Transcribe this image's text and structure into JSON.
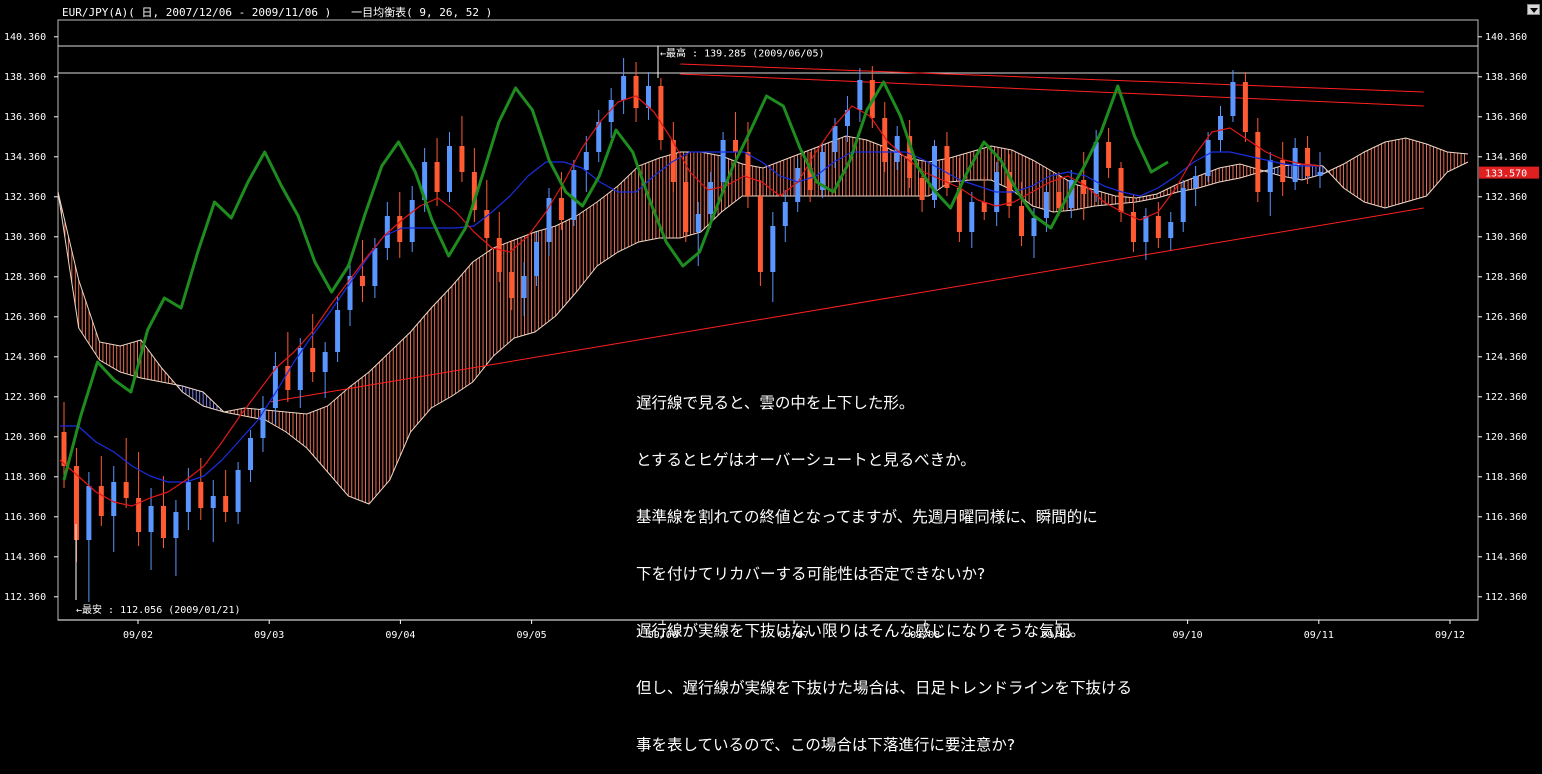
{
  "header": {
    "title": "EUR/JPY(A)( 日, 2007/12/06 - 2009/11/06 )   一目均衡表( 9, 26, 52 )"
  },
  "chart_data": {
    "type": "candlestick",
    "symbol": "EUR/JPY(A)",
    "indicator": "一目均衡表( 9, 26, 52 )",
    "ylim": [
      111.2,
      141.2
    ],
    "y_ticks": [
      "140.360",
      "138.360",
      "136.360",
      "134.360",
      "132.360",
      "130.360",
      "128.360",
      "126.360",
      "124.360",
      "122.360",
      "120.360",
      "118.360",
      "116.360",
      "114.360",
      "112.360"
    ],
    "x_ticks": [
      "09/02",
      "09/03",
      "09/04",
      "09/05",
      "09/06",
      "09/07",
      "09/08",
      "09/09",
      "09/10",
      "09/11",
      "09/12"
    ],
    "current_price": "133.570",
    "high_label": "←最高 : 139.285 (2009/06/05)",
    "low_label": "←最安 : 112.056 (2009/01/21)",
    "high_value": 139.285,
    "low_value": 112.056,
    "candle_ohlc": [
      [
        120.6,
        122.1,
        117.8,
        118.9
      ],
      [
        118.9,
        119.8,
        114.1,
        115.2
      ],
      [
        115.2,
        118.6,
        112.1,
        117.9
      ],
      [
        117.9,
        119.4,
        115.9,
        116.4
      ],
      [
        116.4,
        118.9,
        114.6,
        118.1
      ],
      [
        118.1,
        120.3,
        116.8,
        117.3
      ],
      [
        117.3,
        119.6,
        114.9,
        115.6
      ],
      [
        115.6,
        117.8,
        113.7,
        116.9
      ],
      [
        116.9,
        118.4,
        114.8,
        115.3
      ],
      [
        115.3,
        117.2,
        113.4,
        116.6
      ],
      [
        116.6,
        118.8,
        115.7,
        118.1
      ],
      [
        118.1,
        119.3,
        116.2,
        116.8
      ],
      [
        116.8,
        118.2,
        115.1,
        117.4
      ],
      [
        117.4,
        118.7,
        116.1,
        116.6
      ],
      [
        116.6,
        119.1,
        116.0,
        118.7
      ],
      [
        118.7,
        120.7,
        118.1,
        120.3
      ],
      [
        120.3,
        122.4,
        119.6,
        121.8
      ],
      [
        121.8,
        124.6,
        121.0,
        123.9
      ],
      [
        123.9,
        125.6,
        122.1,
        122.7
      ],
      [
        122.7,
        125.3,
        121.8,
        124.8
      ],
      [
        124.8,
        126.5,
        123.1,
        123.6
      ],
      [
        123.6,
        125.1,
        122.3,
        124.6
      ],
      [
        124.6,
        127.4,
        124.1,
        126.7
      ],
      [
        126.7,
        129.1,
        125.9,
        128.4
      ],
      [
        128.4,
        130.2,
        127.1,
        127.9
      ],
      [
        127.9,
        130.3,
        127.3,
        129.8
      ],
      [
        129.8,
        132.1,
        129.2,
        131.4
      ],
      [
        131.4,
        132.6,
        129.3,
        130.1
      ],
      [
        130.1,
        132.9,
        129.6,
        132.2
      ],
      [
        132.2,
        134.8,
        131.6,
        134.1
      ],
      [
        134.1,
        135.3,
        131.9,
        132.6
      ],
      [
        132.6,
        135.6,
        132.1,
        134.9
      ],
      [
        134.9,
        136.4,
        133.1,
        133.6
      ],
      [
        133.6,
        134.8,
        131.1,
        131.7
      ],
      [
        131.7,
        133.2,
        129.6,
        130.3
      ],
      [
        130.3,
        131.6,
        128.1,
        128.6
      ],
      [
        128.6,
        130.2,
        126.7,
        127.3
      ],
      [
        127.3,
        129.1,
        126.4,
        128.4
      ],
      [
        128.4,
        130.6,
        127.9,
        130.1
      ],
      [
        130.1,
        132.8,
        129.4,
        132.3
      ],
      [
        132.3,
        133.6,
        130.7,
        131.2
      ],
      [
        131.2,
        134.2,
        130.9,
        133.7
      ],
      [
        133.7,
        135.4,
        132.6,
        134.6
      ],
      [
        134.6,
        136.7,
        134.1,
        136.1
      ],
      [
        136.1,
        137.8,
        135.3,
        137.2
      ],
      [
        137.2,
        139.3,
        136.5,
        138.4
      ],
      [
        138.4,
        139.1,
        136.1,
        136.8
      ],
      [
        136.8,
        138.6,
        136.2,
        137.9
      ],
      [
        137.9,
        138.3,
        134.7,
        135.2
      ],
      [
        135.2,
        136.1,
        132.6,
        133.1
      ],
      [
        133.1,
        134.4,
        130.1,
        130.6
      ],
      [
        130.6,
        132.1,
        128.9,
        131.5
      ],
      [
        131.5,
        133.6,
        130.8,
        133.1
      ],
      [
        133.1,
        135.6,
        132.7,
        135.2
      ],
      [
        135.2,
        136.6,
        133.9,
        134.6
      ],
      [
        134.6,
        136.1,
        131.8,
        132.4
      ],
      [
        132.4,
        133.2,
        127.9,
        128.6
      ],
      [
        128.6,
        131.6,
        127.1,
        130.9
      ],
      [
        130.9,
        132.7,
        130.1,
        132.1
      ],
      [
        132.1,
        134.3,
        131.6,
        133.8
      ],
      [
        133.8,
        134.6,
        132.1,
        132.7
      ],
      [
        132.7,
        135.1,
        132.3,
        134.6
      ],
      [
        134.6,
        136.3,
        133.8,
        135.9
      ],
      [
        135.9,
        137.4,
        135.1,
        136.7
      ],
      [
        136.7,
        138.8,
        136.1,
        138.2
      ],
      [
        138.2,
        138.9,
        135.8,
        136.3
      ],
      [
        136.3,
        137.1,
        133.6,
        134.1
      ],
      [
        134.1,
        135.9,
        133.7,
        135.4
      ],
      [
        135.4,
        136.2,
        132.8,
        133.3
      ],
      [
        133.3,
        134.1,
        131.6,
        132.2
      ],
      [
        132.2,
        135.2,
        131.8,
        134.9
      ],
      [
        134.9,
        135.6,
        132.4,
        132.8
      ],
      [
        132.8,
        134.3,
        130.1,
        130.6
      ],
      [
        130.6,
        132.6,
        129.8,
        132.1
      ],
      [
        132.1,
        133.4,
        131.2,
        131.6
      ],
      [
        131.6,
        134.1,
        130.9,
        133.6
      ],
      [
        133.6,
        134.5,
        131.3,
        131.9
      ],
      [
        131.9,
        133.1,
        129.9,
        130.4
      ],
      [
        130.4,
        131.8,
        129.3,
        131.3
      ],
      [
        131.3,
        132.9,
        130.6,
        132.6
      ],
      [
        132.6,
        133.6,
        131.4,
        131.8
      ],
      [
        131.8,
        133.7,
        131.3,
        133.2
      ],
      [
        133.2,
        134.6,
        131.2,
        132.5
      ],
      [
        132.5,
        135.7,
        132.1,
        135.1
      ],
      [
        135.1,
        135.8,
        133.3,
        133.8
      ],
      [
        133.8,
        134.1,
        131.1,
        131.6
      ],
      [
        131.6,
        132.5,
        129.6,
        130.1
      ],
      [
        130.1,
        131.8,
        129.2,
        131.4
      ],
      [
        131.4,
        132.1,
        129.8,
        130.3
      ],
      [
        130.3,
        131.6,
        129.7,
        131.1
      ],
      [
        131.1,
        133.2,
        130.6,
        132.8
      ],
      [
        132.8,
        133.9,
        131.9,
        133.4
      ],
      [
        133.4,
        135.6,
        133.1,
        135.2
      ],
      [
        135.2,
        136.9,
        134.6,
        136.4
      ],
      [
        136.4,
        138.7,
        136.1,
        138.1
      ],
      [
        138.1,
        138.6,
        135.1,
        135.6
      ],
      [
        135.6,
        136.3,
        132.1,
        132.6
      ],
      [
        132.6,
        134.6,
        131.4,
        134.2
      ],
      [
        134.2,
        135.1,
        132.4,
        133.1
      ],
      [
        133.1,
        135.3,
        132.7,
        134.8
      ],
      [
        134.8,
        135.4,
        133.0,
        133.4
      ],
      [
        133.4,
        134.6,
        132.8,
        133.6
      ]
    ],
    "chikou_span": [
      118.2,
      121.4,
      124.1,
      123.2,
      122.6,
      125.7,
      127.3,
      126.8,
      129.6,
      132.1,
      131.3,
      133.1,
      134.6,
      132.9,
      131.4,
      129.1,
      127.6,
      128.9,
      131.5,
      133.9,
      135.1,
      133.6,
      131.2,
      129.4,
      130.8,
      133.4,
      136.1,
      137.8,
      136.7,
      134.2,
      132.6,
      131.9,
      133.4,
      135.7,
      134.6,
      132.2,
      130.1,
      128.9,
      129.6,
      131.8,
      133.9,
      135.6,
      137.4,
      136.9,
      134.8,
      133.1,
      132.6,
      134.2,
      136.7,
      138.1,
      136.4,
      133.9,
      132.7,
      131.8,
      133.6,
      135.1,
      134.2,
      132.6,
      131.4,
      130.8,
      132.4,
      133.9,
      135.6,
      137.9,
      135.4,
      133.6,
      134.1
    ],
    "tenkan_sen": [
      119.2,
      118.4,
      117.6,
      117.1,
      116.9,
      117.3,
      117.6,
      118.2,
      118.9,
      120.1,
      121.4,
      122.6,
      123.8,
      124.6,
      125.6,
      126.9,
      128.1,
      129.3,
      130.4,
      131.2,
      131.9,
      132.3,
      131.6,
      130.6,
      129.8,
      129.6,
      130.4,
      131.6,
      133.1,
      134.8,
      136.1,
      137.1,
      137.4,
      136.6,
      135.2,
      133.6,
      132.7,
      132.9,
      133.4,
      133.1,
      132.4,
      133.1,
      134.6,
      135.9,
      136.9,
      136.4,
      135.1,
      134.3,
      133.6,
      133.2,
      132.8,
      132.2,
      131.9,
      132.1,
      132.6,
      133.1,
      133.4,
      132.9,
      132.1,
      131.6,
      131.2,
      131.6,
      132.8,
      134.4,
      135.6,
      135.8,
      135.2,
      134.6,
      134.2,
      134.0,
      133.9
    ],
    "kijun_sen": [
      120.9,
      120.9,
      120.1,
      119.6,
      118.9,
      118.4,
      118.1,
      118.1,
      118.4,
      119.2,
      120.2,
      121.2,
      122.6,
      124.1,
      125.4,
      126.6,
      127.9,
      129.2,
      130.4,
      130.8,
      130.8,
      130.8,
      130.8,
      130.9,
      131.6,
      132.4,
      133.4,
      134.1,
      134.1,
      133.8,
      133.1,
      132.6,
      132.6,
      133.4,
      134.1,
      134.6,
      134.6,
      134.6,
      134.6,
      134.1,
      133.4,
      133.1,
      133.4,
      134.1,
      134.6,
      134.6,
      134.6,
      134.6,
      134.2,
      133.7,
      133.2,
      132.9,
      132.6,
      132.6,
      132.9,
      133.4,
      133.6,
      133.4,
      132.9,
      132.6,
      132.4,
      132.8,
      133.4,
      134.1,
      134.6,
      134.6,
      134.4,
      134.2,
      134.0,
      133.9,
      133.9
    ],
    "senkou_a": [
      132.6,
      128.2,
      125.1,
      124.9,
      125.2,
      123.8,
      122.6,
      121.9,
      121.6,
      121.8,
      121.7,
      121.6,
      121.5,
      121.9,
      122.8,
      123.6,
      124.6,
      125.6,
      126.8,
      127.9,
      129.1,
      129.8,
      130.2,
      130.6,
      130.9,
      131.4,
      132.1,
      132.9,
      133.9,
      134.3,
      134.6,
      134.6,
      134.4,
      134.0,
      133.8,
      134.2,
      134.6,
      135.0,
      135.4,
      135.2,
      134.8,
      134.3,
      134.1,
      134.3,
      134.6,
      134.9,
      134.7,
      134.2,
      133.6,
      133.0,
      132.7,
      132.4,
      132.3,
      132.5,
      133.0,
      133.4,
      133.8,
      134.0,
      133.7,
      133.4,
      133.2,
      133.5,
      134.0,
      134.6,
      135.1,
      135.3,
      135.0,
      134.6,
      134.5
    ],
    "senkou_b": [
      132.6,
      125.8,
      124.2,
      123.6,
      123.3,
      123.1,
      122.9,
      122.6,
      121.6,
      121.4,
      121.2,
      120.6,
      119.8,
      118.6,
      117.4,
      117.0,
      118.2,
      120.6,
      121.8,
      122.4,
      123.1,
      124.4,
      125.3,
      125.6,
      126.4,
      127.6,
      128.9,
      129.6,
      130.1,
      130.3,
      130.3,
      130.6,
      131.6,
      132.4,
      132.4,
      132.4,
      132.4,
      132.4,
      132.4,
      132.4,
      132.4,
      132.4,
      132.4,
      133.1,
      133.2,
      133.2,
      132.7,
      131.9,
      131.6,
      131.7,
      131.9,
      132.0,
      132.1,
      132.3,
      132.6,
      132.8,
      133.1,
      133.3,
      133.6,
      133.9,
      134.0,
      133.9,
      132.8,
      132.1,
      131.8,
      132.1,
      132.4,
      133.6,
      134.1
    ],
    "trendlines": [
      {
        "from": [
          "2009/03/01",
          122.1
        ],
        "to": [
          "2009/11/25",
          131.8
        ]
      },
      {
        "from": [
          "2009/06/05",
          139.0
        ],
        "to": [
          "2009/11/25",
          137.6
        ]
      },
      {
        "from": [
          "2009/06/05",
          138.5
        ],
        "to": [
          "2009/11/25",
          136.9
        ]
      }
    ],
    "colors": {
      "up_candle": "#5a96ff",
      "down_candle": "#ff5a32",
      "chikou": "#1e8c1e",
      "tenkan": "#e01818",
      "kijun": "#1a2ee0",
      "kumo_bull": "#ff7a5a",
      "kumo_bear": "#8a8cff",
      "trendline": "#ff2020",
      "price_tag": "#e02020"
    }
  },
  "comment": {
    "lines": [
      "遅行線で見ると、雲の中を上下した形。",
      "とするとヒゲはオーバーシュートと見るべきか。",
      "基準線を割れての終値となってますが、先週月曜同様に、瞬間的に",
      "下を付けてリカバーする可能性は否定できないか?",
      "遅行線が実線を下抜けない限りはそんな感じになりそうな気配。",
      "但し、遅行線が実線を下抜けた場合は、日足トレンドラインを下抜ける",
      "事を表しているので、この場合は下落進行に要注意か?"
    ]
  }
}
